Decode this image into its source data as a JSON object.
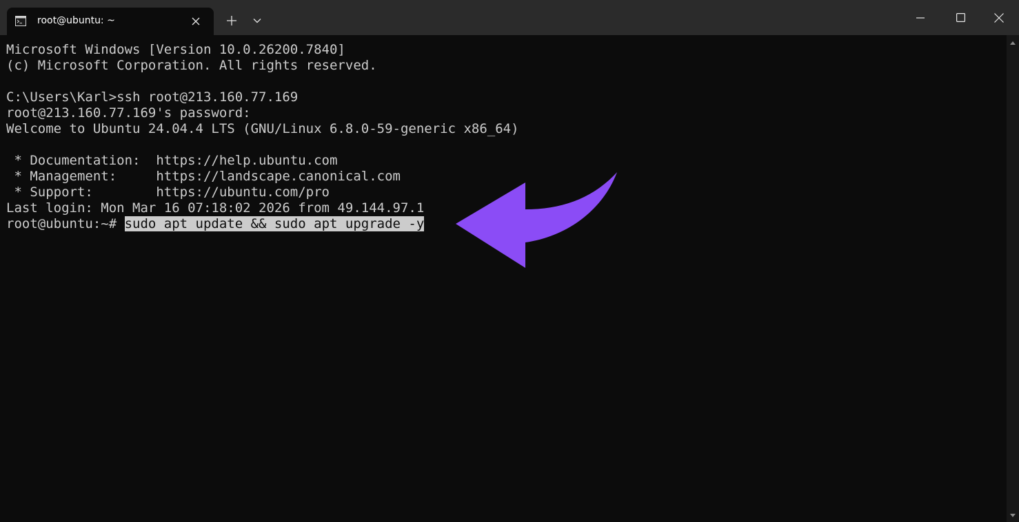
{
  "window": {
    "tab_title": "root@ubuntu: ~",
    "tab_icon": "terminal-icon",
    "buttons": {
      "new_tab": "+",
      "dropdown": "chevron-down-icon",
      "minimize": "minimize-icon",
      "maximize": "maximize-icon",
      "close": "close-icon"
    }
  },
  "terminal": {
    "lines": [
      "Microsoft Windows [Version 10.0.26200.7840]",
      "(c) Microsoft Corporation. All rights reserved.",
      "",
      "C:\\Users\\Karl>ssh root@213.160.77.169",
      "root@213.160.77.169's password:",
      "Welcome to Ubuntu 24.04.4 LTS (GNU/Linux 6.8.0-59-generic x86_64)",
      "",
      " * Documentation:  https://help.ubuntu.com",
      " * Management:     https://landscape.canonical.com",
      " * Support:        https://ubuntu.com/pro",
      "Last login: Mon Mar 16 07:18:02 2026 from 49.144.97.1"
    ],
    "prompt": "root@ubuntu:~# ",
    "command": "sudo apt update && sudo apt upgrade -y"
  },
  "colors": {
    "background": "#0c0c0c",
    "titlebar": "#2b2b2b",
    "text": "#cccccc",
    "arrow": "#8b4cf6"
  }
}
